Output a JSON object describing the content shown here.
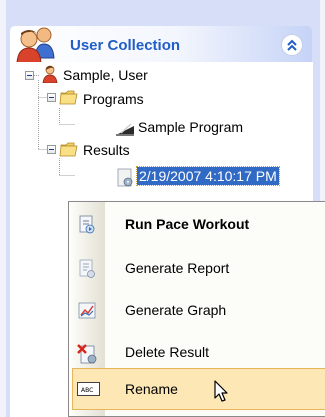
{
  "panel": {
    "title": "User Collection",
    "title_color": "#215dc6",
    "header_icon": "users-icon",
    "collapse_icon": "double-chevron-up-icon"
  },
  "tree": {
    "root": {
      "label": "Sample, User",
      "icon": "user-icon",
      "expanded": true
    },
    "programs": {
      "label": "Programs",
      "icon": "folder-icon",
      "expanded": true
    },
    "program_item": {
      "label": "Sample Program",
      "icon": "program-icon"
    },
    "results": {
      "label": "Results",
      "icon": "folder-icon",
      "expanded": true
    },
    "result_item": {
      "label": "2/19/2007 4:10:17 PM",
      "icon": "result-icon",
      "selected": true
    }
  },
  "context_menu": {
    "items": [
      {
        "label": "Run Pace Workout",
        "icon": "run-workout-icon",
        "bold": true
      },
      {
        "label": "Generate Report",
        "icon": "report-icon"
      },
      {
        "label": "Generate Graph",
        "icon": "graph-icon"
      },
      {
        "label": "Delete Result",
        "icon": "delete-result-icon"
      },
      {
        "label": "Rename",
        "icon": "rename-icon",
        "hovered": true
      }
    ]
  }
}
